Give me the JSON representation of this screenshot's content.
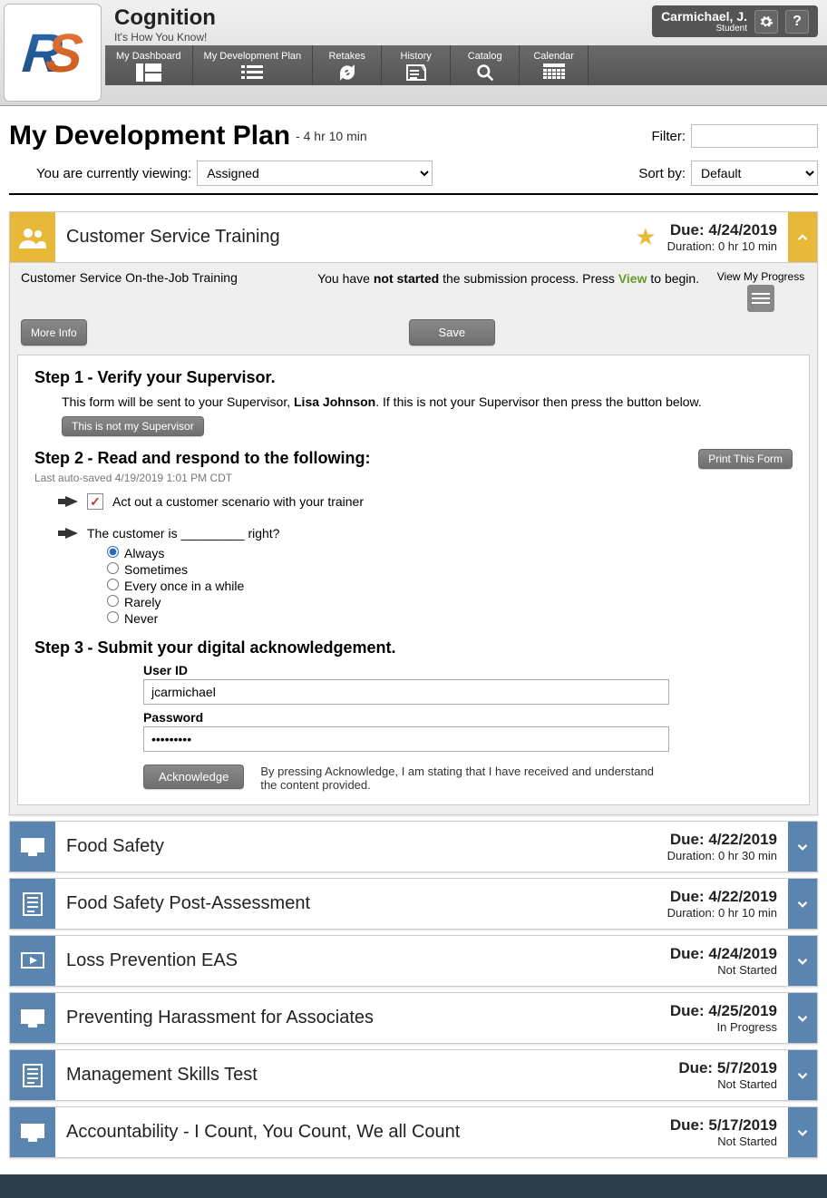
{
  "brand": {
    "title": "Cognition",
    "tagline": "It's How You Know!"
  },
  "user": {
    "name": "Carmichael, J.",
    "role": "Student"
  },
  "nav": {
    "items": [
      {
        "label": "My Dashboard"
      },
      {
        "label": "My Development Plan"
      },
      {
        "label": "Retakes"
      },
      {
        "label": "History"
      },
      {
        "label": "Catalog"
      },
      {
        "label": "Calendar"
      }
    ]
  },
  "page": {
    "title": "My Development Plan",
    "duration": "- 4 hr 10 min",
    "viewing_label": "You are currently viewing:",
    "viewing_value": "Assigned",
    "filter_label": "Filter:",
    "filter_value": "",
    "sort_label": "Sort by:",
    "sort_value": "Default"
  },
  "expanded": {
    "title": "Customer Service Training",
    "due": "Due: 4/24/2019",
    "duration": "Duration: 0 hr 10 min",
    "subtitle": "Customer Service On-the-Job Training",
    "status_pre": "You have ",
    "status_bold": "not started",
    "status_mid": " the submission process. Press ",
    "status_view": "View",
    "status_post": " to begin.",
    "view_progress": "View My Progress",
    "more_info": "More Info",
    "save": "Save",
    "print": "Print This Form",
    "step1_title": "Step 1",
    "step1_sub": "- Verify your Supervisor.",
    "step1_text_a": "This form will be sent to your Supervisor, ",
    "step1_name": "Lisa Johnson",
    "step1_text_b": ". If this is not your Supervisor then press the button below.",
    "not_supervisor": "This is not my Supervisor",
    "step2_title": "Step 2",
    "step2_sub": "- Read and respond to the following:",
    "autosave": "Last auto-saved 4/19/2019 1:01 PM CDT",
    "check1": "Act out a customer scenario with your trainer",
    "question": "The customer is _________ right?",
    "options": [
      "Always",
      "Sometimes",
      "Every once in a while",
      "Rarely",
      "Never"
    ],
    "step3_title": "Step 3",
    "step3_sub": "- Submit your digital acknowledgement.",
    "userid_label": "User ID",
    "userid_value": "jcarmichael",
    "password_label": "Password",
    "password_value": "•••••••••",
    "ack_btn": "Acknowledge",
    "ack_text": "By pressing Acknowledge, I am stating that I have received and understand the content provided."
  },
  "courses": [
    {
      "title": "Food Safety",
      "due": "Due: 4/22/2019",
      "meta": "Duration: 0 hr 30 min",
      "icon": "monitor"
    },
    {
      "title": "Food Safety Post-Assessment",
      "due": "Due: 4/22/2019",
      "meta": "Duration: 0 hr 10 min",
      "icon": "doc"
    },
    {
      "title": "Loss Prevention EAS",
      "due": "Due: 4/24/2019",
      "meta": "Not Started",
      "icon": "play"
    },
    {
      "title": "Preventing Harassment for Associates",
      "due": "Due: 4/25/2019",
      "meta": "In Progress",
      "icon": "monitor"
    },
    {
      "title": "Management Skills Test",
      "due": "Due: 5/7/2019",
      "meta": "Not Started",
      "icon": "doc"
    },
    {
      "title": "Accountability - I Count, You Count, We all Count",
      "due": "Due: 5/17/2019",
      "meta": "Not Started",
      "icon": "monitor"
    }
  ]
}
